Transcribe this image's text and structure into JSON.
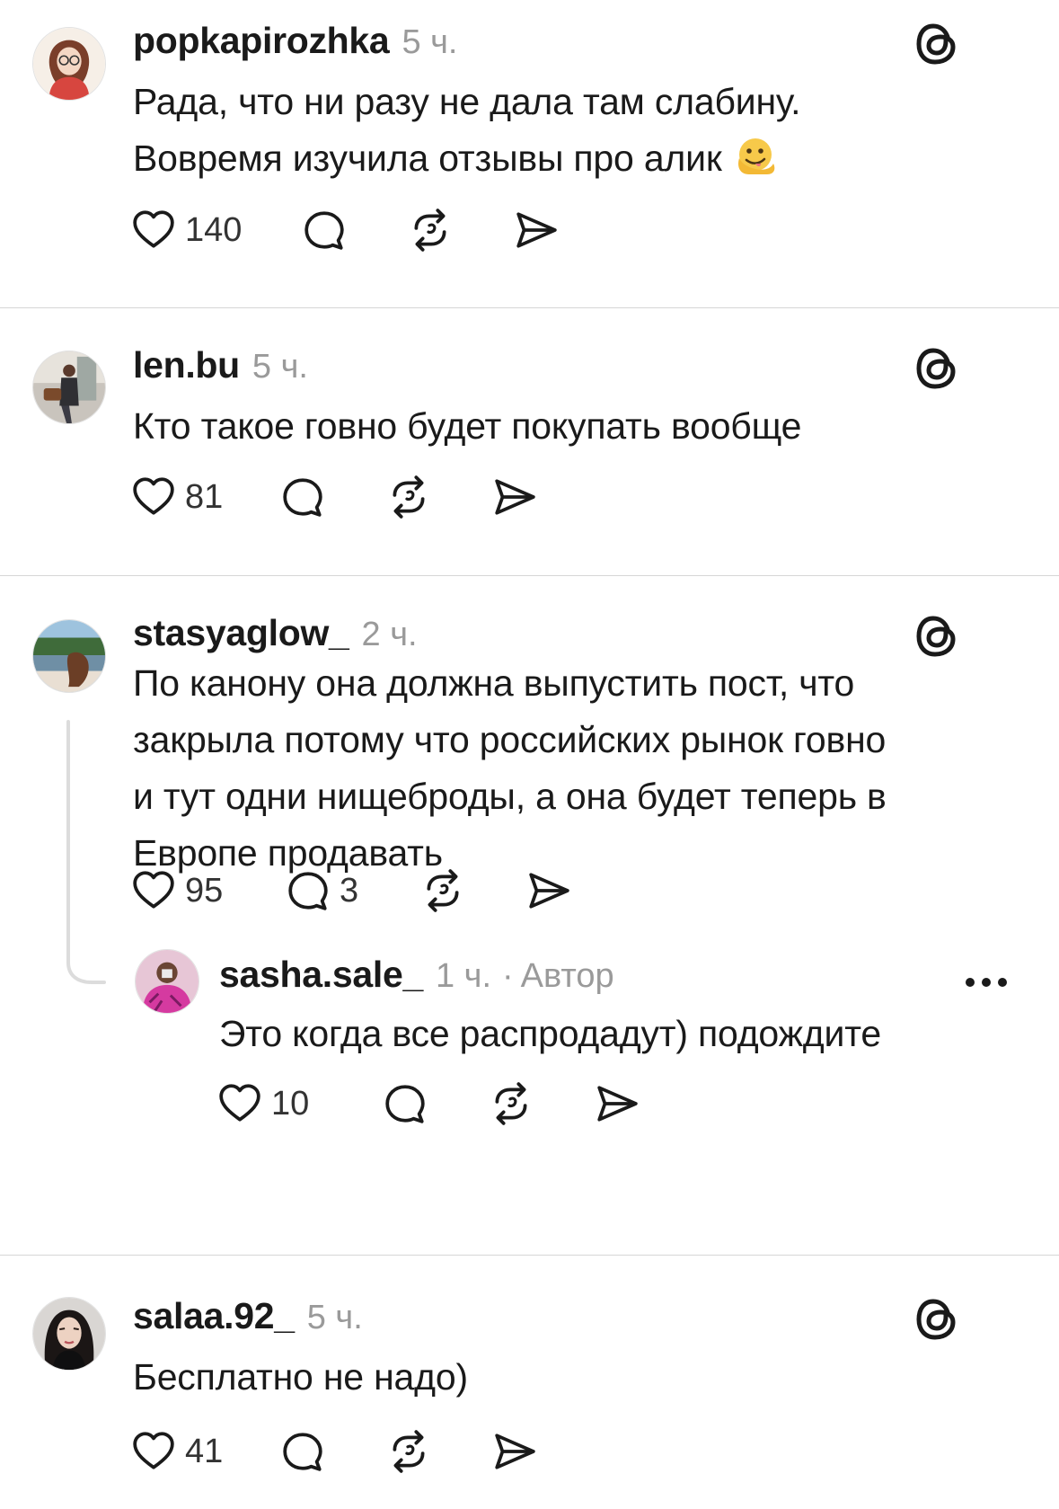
{
  "posts": [
    {
      "username": "popkapirozhka",
      "time": "5 ч.",
      "text_lines": [
        "Рада, что ни разу не дала там слабину.",
        "Вовремя изучила отзывы про алик"
      ],
      "emoji": "melting-face",
      "likes": "140",
      "replies": ""
    },
    {
      "username": "len.bu",
      "time": "5 ч.",
      "text_lines": [
        "Кто такое говно будет покупать вообще"
      ],
      "likes": "81",
      "replies": ""
    },
    {
      "username": "stasyaglow_",
      "time": "2 ч.",
      "text_lines": [
        "По канону она должна выпустить пост, что",
        "закрыла потому что российских рынок говно",
        "и тут одни нищеброды, а она будет теперь в",
        "Европе продавать"
      ],
      "likes": "95",
      "replies": "3"
    },
    {
      "username": "sasha.sale_",
      "time": "1 ч.",
      "separator": "·",
      "author_badge": "Автор",
      "text_lines": [
        "Это когда все распродадут) подождите"
      ],
      "likes": "10",
      "replies": ""
    },
    {
      "username": "salaa.92_",
      "time": "5 ч.",
      "text_lines": [
        "Бесплатно не надо)"
      ],
      "likes": "41",
      "replies": ""
    }
  ],
  "icons": {
    "like": "heart-icon",
    "reply": "comment-icon",
    "repost": "repost-icon",
    "share": "share-icon",
    "platform": "threads-logo-icon",
    "more": "more-icon"
  },
  "colors": {
    "text": "#1a1a1a",
    "muted": "#9a9a9a",
    "divider": "#d6d6d6",
    "background": "#ffffff"
  }
}
